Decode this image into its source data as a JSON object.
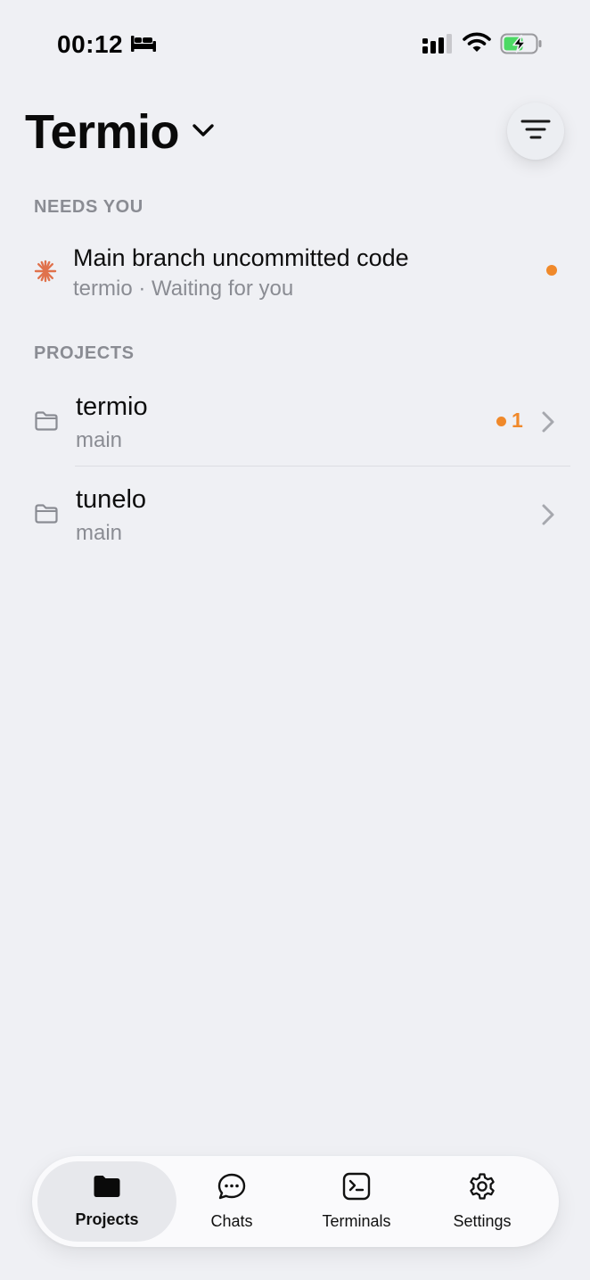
{
  "status_bar": {
    "time": "00:12",
    "icons": [
      "bed-icon",
      "cellular-signal-icon",
      "wifi-icon",
      "battery-charging-icon"
    ]
  },
  "header": {
    "title": "Termio",
    "title_dropdown_icon": "chevron-down-icon",
    "filter_icon": "filter-lines-icon"
  },
  "needs_you": {
    "label": "NEEDS YOU",
    "items": [
      {
        "icon": "spark-icon",
        "title": "Main branch uncommitted code",
        "subtitle": "termio · Waiting for you",
        "indicator_color": "#f0892a"
      }
    ]
  },
  "projects": {
    "label": "PROJECTS",
    "items": [
      {
        "icon": "folder-icon",
        "name": "termio",
        "branch": "main",
        "badge_count": "1",
        "badge_color": "#f0892a"
      },
      {
        "icon": "folder-icon",
        "name": "tunelo",
        "branch": "main"
      }
    ]
  },
  "tab_bar": {
    "tabs": [
      {
        "label": "Projects",
        "icon": "folder-filled-icon",
        "active": true
      },
      {
        "label": "Chats",
        "icon": "chat-bubble-icon",
        "active": false
      },
      {
        "label": "Terminals",
        "icon": "terminal-icon",
        "active": false
      },
      {
        "label": "Settings",
        "icon": "gear-icon",
        "active": false
      }
    ]
  },
  "colors": {
    "background": "#eff0f4",
    "accent": "#f0892a",
    "spark": "#e0724c",
    "secondary_text": "#8a8c93",
    "battery_green": "#4cd964"
  }
}
